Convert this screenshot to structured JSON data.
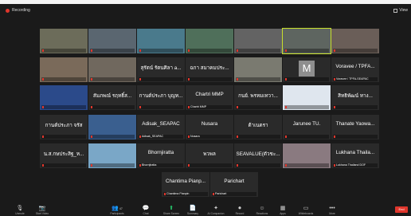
{
  "window": {
    "recording_label": "Recording",
    "view_label": "View"
  },
  "gallery": [
    [
      {
        "display_name": "",
        "label": "",
        "tone": "#6c6c5a"
      },
      {
        "display_name": "",
        "label": "",
        "tone": "#5a6670"
      },
      {
        "display_name": "",
        "label": "",
        "tone": "#4a7a8c"
      },
      {
        "display_name": "",
        "label": "",
        "tone": "#4f6f5a"
      },
      {
        "display_name": "",
        "label": "",
        "tone": "#636363"
      },
      {
        "display_name": "",
        "label": "",
        "tone": "#5e6560",
        "active": true
      },
      {
        "display_name": "",
        "label": "",
        "tone": "#6a5e58"
      }
    ],
    [
      {
        "display_name": "",
        "label": "",
        "tone": "#7a6a5a"
      },
      {
        "display_name": "",
        "label": "",
        "tone": "#70685e"
      },
      {
        "display_name": "สุรัตน์ รัตนศิลา a...",
        "label": "",
        "tone": ""
      },
      {
        "display_name": "ฉกา สมาคมประ...",
        "label": "",
        "tone": ""
      },
      {
        "display_name": "",
        "label": "",
        "tone": "#7a7a70"
      },
      {
        "display_name": "",
        "label": "",
        "tone": "",
        "letter": "M"
      },
      {
        "display_name": "Voravee / TPFA...",
        "label": "Voravee / TPFA-SEAPAC",
        "tone": ""
      }
    ],
    [
      {
        "display_name": "",
        "label": "",
        "tone": "#2b4a8a"
      },
      {
        "display_name": "สัมภพณ์ รฤทธิ์ส...",
        "label": "",
        "tone": ""
      },
      {
        "display_name": "กานต์ประภา บุญท...",
        "label": "",
        "tone": ""
      },
      {
        "display_name": "Chartri MMP",
        "label": "Chartri MMP",
        "tone": ""
      },
      {
        "display_name": "กนย์. พรหมเทวา...",
        "label": "",
        "tone": ""
      },
      {
        "display_name": "",
        "label": "",
        "tone": "#dfe6ee"
      },
      {
        "display_name": "สิทธิพัฒน์ ทาง...",
        "label": "",
        "tone": ""
      }
    ],
    [
      {
        "display_name": "กานต์ประภา จรัส",
        "label": "",
        "tone": ""
      },
      {
        "display_name": "",
        "label": "",
        "tone": "#3a5f8f"
      },
      {
        "display_name": "Adisak_SEAPAC",
        "label": "Adisak_SEAPAC",
        "tone": ""
      },
      {
        "display_name": "Nusara",
        "label": "Nusara",
        "tone": ""
      },
      {
        "display_name": "ต้าเนตรา",
        "label": "",
        "tone": ""
      },
      {
        "display_name": "Jarunee TU.",
        "label": "",
        "tone": ""
      },
      {
        "display_name": "Thanate Yaowa...",
        "label": "",
        "tone": ""
      }
    ],
    [
      {
        "display_name": "น.ส.กษประสิฐ_ห...",
        "label": "",
        "tone": ""
      },
      {
        "display_name": "",
        "label": "",
        "tone": "#7aa7c7"
      },
      {
        "display_name": "Bhornjiratta",
        "label": "Bhornjiratta",
        "tone": ""
      },
      {
        "display_name": "พวพล",
        "label": "",
        "tone": ""
      },
      {
        "display_name": "SEAVALUE(ตัวชะ...",
        "label": "",
        "tone": ""
      },
      {
        "display_name": "",
        "label": "",
        "tone": "#8a7a80"
      },
      {
        "display_name": "Lukhana Thaila...",
        "label": "Lukhana Thailand DOF",
        "tone": ""
      }
    ],
    [
      {
        "display_name": "Chantima Pianp...",
        "label": "Chantima Pianpin",
        "tone": ""
      },
      {
        "display_name": "Parichart",
        "label": "Parichart",
        "tone": ""
      }
    ]
  ],
  "toolbar": {
    "items": [
      {
        "label": "Unmute",
        "icon": "🎙"
      },
      {
        "label": "Start Video",
        "icon": "📷"
      },
      {
        "label": "Participants",
        "icon": "👥",
        "count": "47"
      },
      {
        "label": "Chat",
        "icon": "💬"
      },
      {
        "label": "Share Screen",
        "icon": "⬆"
      },
      {
        "label": "Summary",
        "icon": "📄"
      },
      {
        "label": "AI Companion",
        "icon": "✦"
      },
      {
        "label": "Record",
        "icon": "⏺"
      },
      {
        "label": "Reactions",
        "icon": "☺"
      },
      {
        "label": "Apps",
        "icon": "▦"
      },
      {
        "label": "Whiteboards",
        "icon": "▭"
      },
      {
        "label": "More",
        "icon": "•••"
      }
    ],
    "end_label": "End"
  },
  "colors": {
    "frame_bg": "#1a1a1a",
    "tile_bg": "#2a2a2a",
    "muted_red": "#e0362c",
    "active_border": "#c9e02c"
  }
}
